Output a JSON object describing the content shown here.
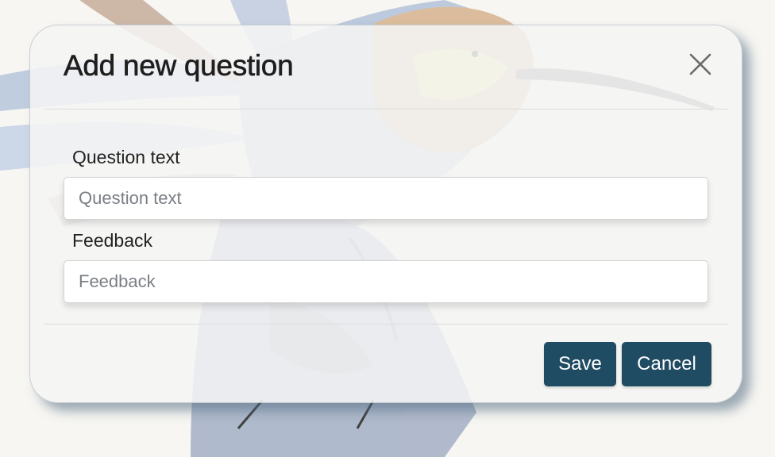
{
  "dialog": {
    "title": "Add new question",
    "close_icon": "close-icon"
  },
  "form": {
    "question": {
      "label": "Question text",
      "placeholder": "Question text",
      "value": ""
    },
    "feedback": {
      "label": "Feedback",
      "placeholder": "Feedback",
      "value": ""
    }
  },
  "footer": {
    "save_label": "Save",
    "cancel_label": "Cancel"
  },
  "colors": {
    "primary_button": "#1f4b63",
    "modal_background": "#f5f5f5",
    "page_background": "#f7f6f2"
  }
}
